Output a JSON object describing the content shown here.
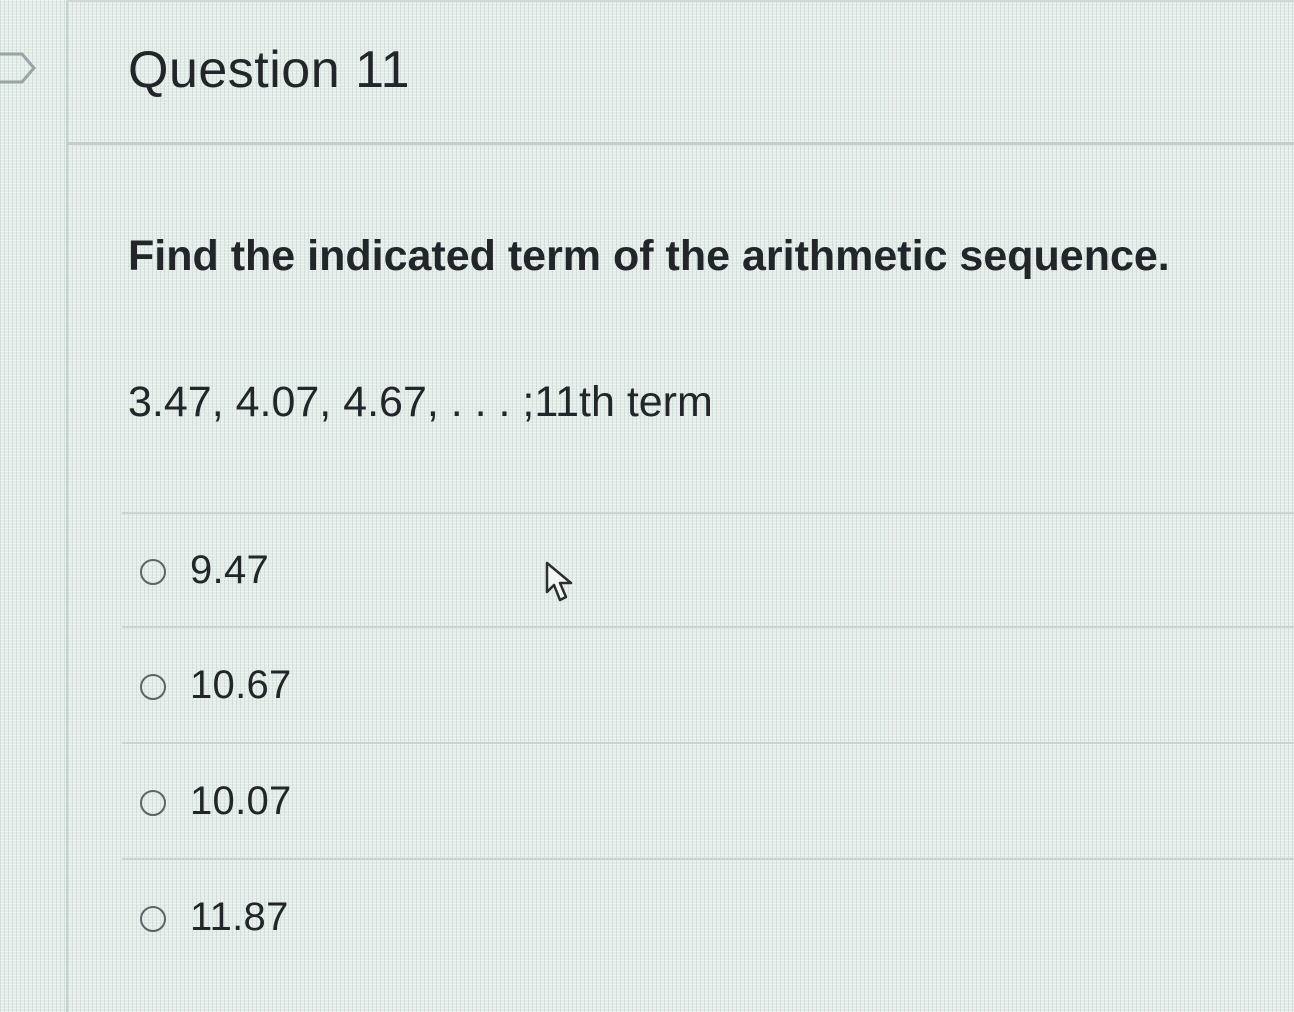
{
  "question": {
    "title": "Question 11",
    "prompt": "Find the indicated term of the arithmetic sequence.",
    "sequence": "3.47, 4.07, 4.67, . . . ;11th term"
  },
  "answers": [
    {
      "label": "9.47",
      "selected": false
    },
    {
      "label": "10.67",
      "selected": false
    },
    {
      "label": "10.07",
      "selected": false
    },
    {
      "label": "11.87",
      "selected": false
    }
  ],
  "icons": {
    "flag": "flag-icon",
    "radio": "radio-button-icon",
    "cursor": "mouse-pointer-icon"
  },
  "colors": {
    "text": "#22262a",
    "divider": "#ccd3d0",
    "background": "#e6ebe8"
  }
}
